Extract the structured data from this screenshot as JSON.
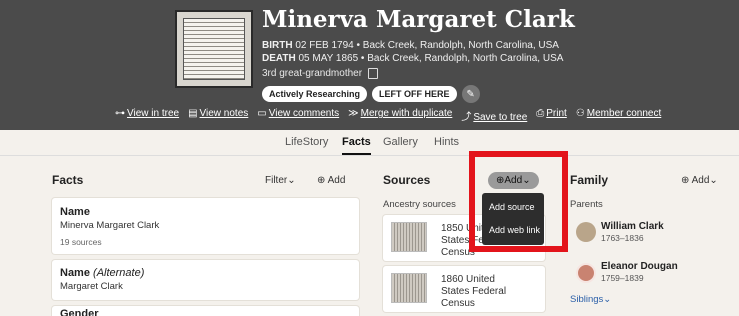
{
  "person": {
    "name": "Minerva Margaret Clark",
    "birth_label": "BIRTH",
    "birth_value": "02 FEB 1794 • Back Creek, Randolph, North Carolina, USA",
    "death_label": "DEATH",
    "death_value": "05 MAY 1865 • Back Creek, Randolph, North Carolina, USA",
    "relationship": "3rd great-grandmother"
  },
  "badges": [
    "Actively Researching",
    "LEFT OFF HERE"
  ],
  "actions": [
    {
      "icon": "tree-icon",
      "glyph": "⊶",
      "label": "View in tree"
    },
    {
      "icon": "notes-icon",
      "glyph": "▤",
      "label": "View notes"
    },
    {
      "icon": "comments-icon",
      "glyph": "▭",
      "label": "View comments"
    },
    {
      "icon": "merge-icon",
      "glyph": "≫",
      "label": "Merge with duplicate"
    },
    {
      "icon": "save-icon",
      "glyph": "⤴",
      "label": "Save to tree"
    },
    {
      "icon": "print-icon",
      "glyph": "⎙",
      "label": "Print"
    },
    {
      "icon": "member-icon",
      "glyph": "⚇",
      "label": "Member connect"
    }
  ],
  "tabs": [
    "LifeStory",
    "Facts",
    "Gallery",
    "Hints"
  ],
  "facts": {
    "title": "Facts",
    "filter_label": "Filter",
    "add_label": "Add",
    "items": [
      {
        "title": "Name",
        "value": "Minerva Margaret Clark",
        "meta": "19 sources"
      },
      {
        "title": "Name",
        "qualifier": "(Alternate)",
        "value": "Margaret Clark"
      },
      {
        "title": "Gender"
      }
    ]
  },
  "sources": {
    "title": "Sources",
    "add_label": "Add",
    "subheading": "Ancestry sources",
    "items": [
      "1850 United States Federal Census",
      "1860 United States Federal Census"
    ],
    "dropdown": [
      "Add source",
      "Add web link"
    ]
  },
  "family": {
    "title": "Family",
    "add_label": "Add",
    "parents_label": "Parents",
    "parents": [
      {
        "name": "William Clark",
        "years": "1763–1836"
      },
      {
        "name": "Eleanor Dougan",
        "years": "1759–1839"
      }
    ],
    "siblings_label": "Siblings"
  },
  "colors": {
    "header": "#4b4b4b",
    "highlight": "#e3141b",
    "page": "#f4f1ec"
  }
}
